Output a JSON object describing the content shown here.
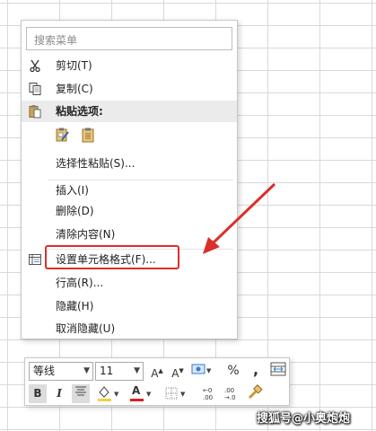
{
  "context_menu": {
    "search_placeholder": "搜索菜单",
    "items": [
      {
        "id": "cut",
        "label": "剪切(T)"
      },
      {
        "id": "copy",
        "label": "复制(C)"
      },
      {
        "id": "paste_options",
        "label": "粘贴选项:"
      },
      {
        "id": "paste_special",
        "label": "选择性粘贴(S)..."
      },
      {
        "id": "insert",
        "label": "插入(I)"
      },
      {
        "id": "delete",
        "label": "删除(D)"
      },
      {
        "id": "clear_contents",
        "label": "清除内容(N)"
      },
      {
        "id": "format_cells",
        "label": "设置单元格格式(F)..."
      },
      {
        "id": "row_height",
        "label": "行高(R)..."
      },
      {
        "id": "hide",
        "label": "隐藏(H)"
      },
      {
        "id": "unhide",
        "label": "取消隐藏(U)"
      }
    ]
  },
  "mini_toolbar": {
    "font_name": "等线",
    "font_size": "11",
    "percent": "%",
    "comma": ",",
    "bold": "B",
    "italic": "I",
    "font_color_letter": "A",
    "increase_font_letter": "A",
    "decrease_font_letter": "A"
  },
  "watermark": "搜狐号@小奥炮炮",
  "colors": {
    "highlight": "#d9302b",
    "arrow": "#d9302b",
    "font_color_bar": "#d62020",
    "fill_bar": "#f4d03f"
  }
}
